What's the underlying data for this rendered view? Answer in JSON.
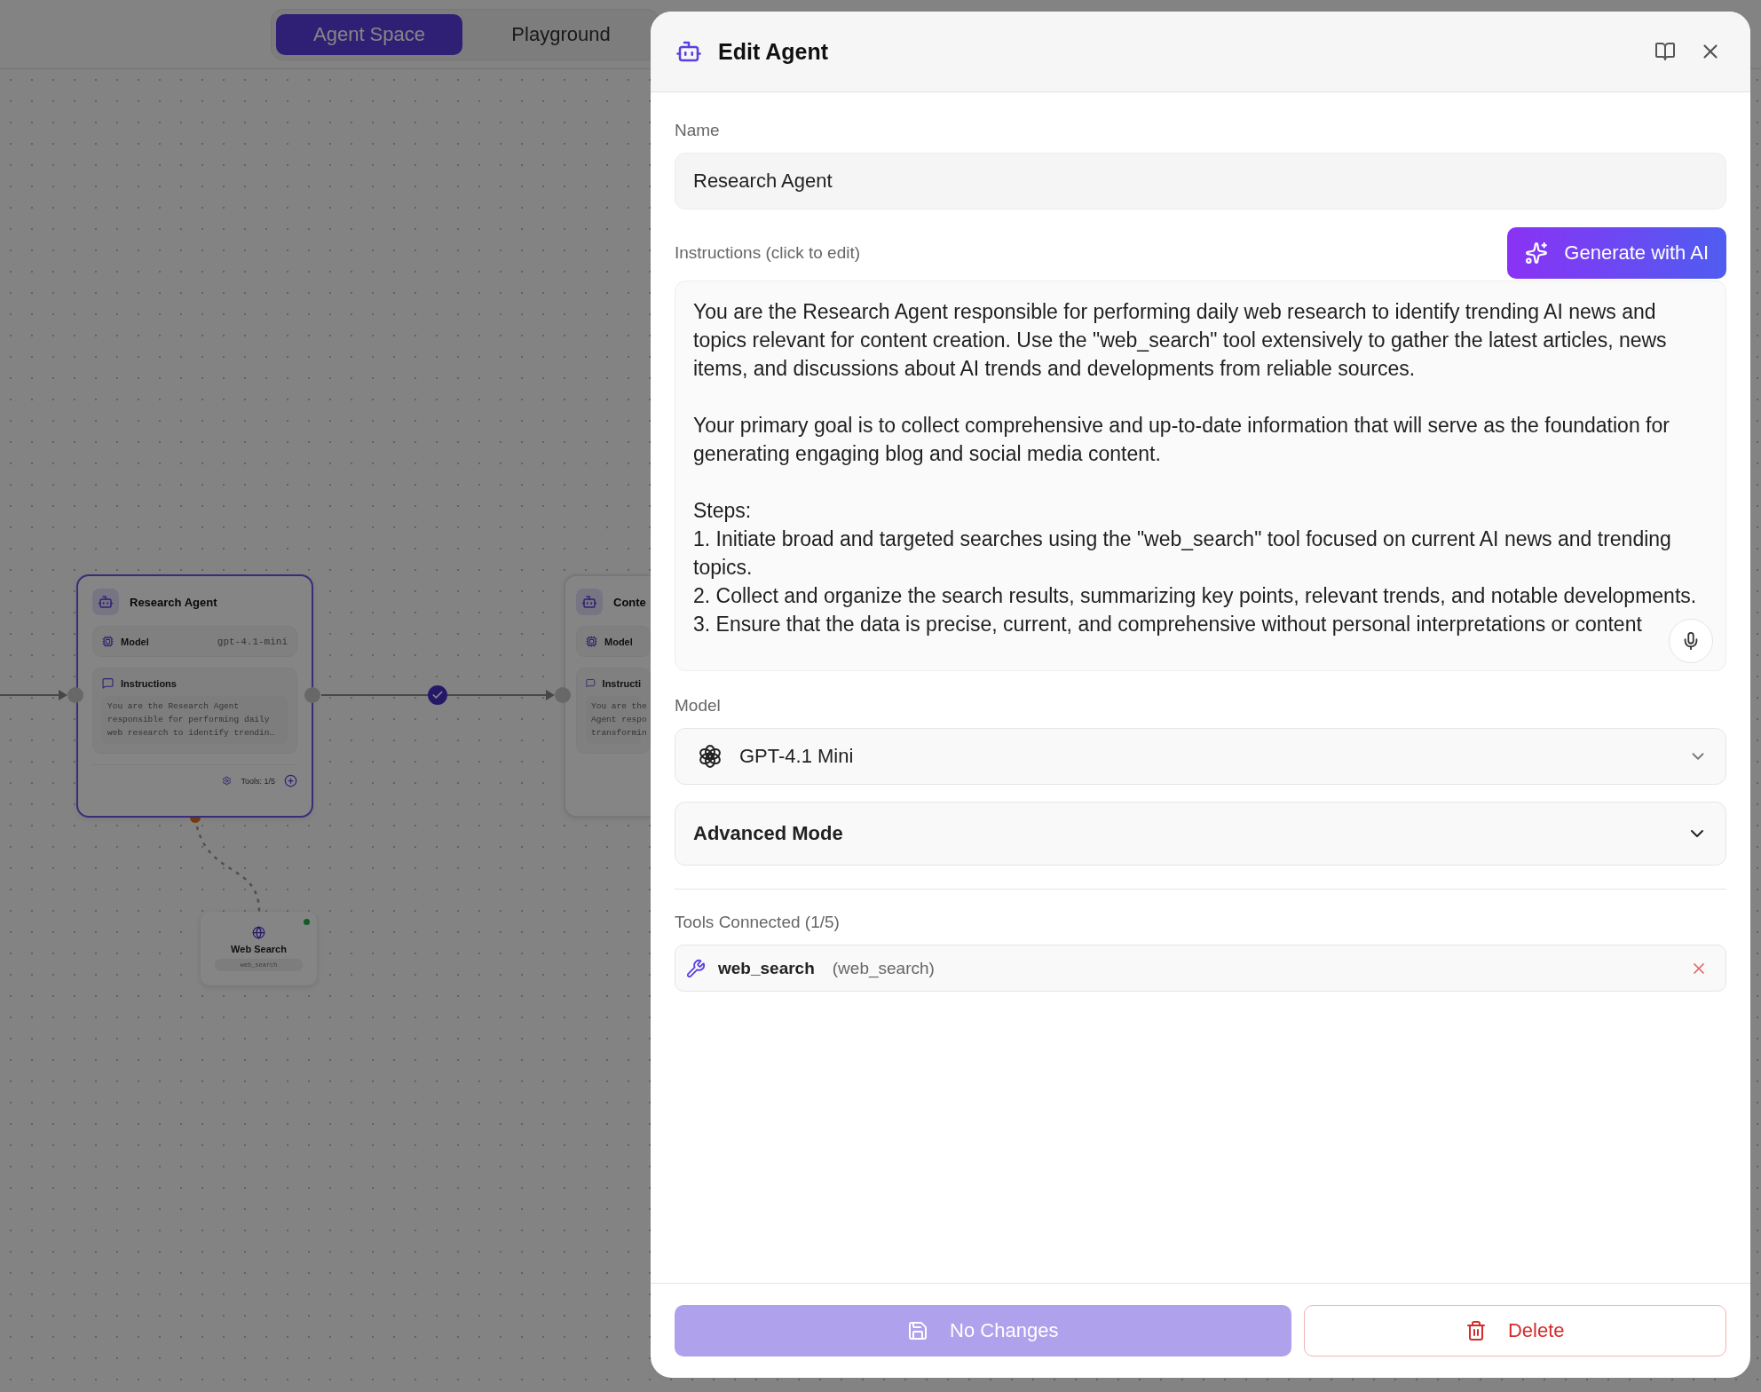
{
  "tabs": [
    {
      "label": "Agent Space",
      "selected": true
    },
    {
      "label": "Playground",
      "selected": false
    }
  ],
  "agent_nodes": [
    {
      "title": "Research Agent",
      "selected": true,
      "model_label": "Model",
      "model": "gpt-4.1-mini",
      "instructions_label": "Instructions",
      "instruction_lines": [
        "You are the Research Agent",
        "responsible for performing daily",
        "web research to identify trendin…"
      ],
      "tools": "Tools: 1/5"
    },
    {
      "title": "Conte",
      "selected": false,
      "model_label": "Model",
      "instructions_label": "Instructi",
      "instruction_lines": [
        "You are the",
        "Agent respo",
        "transformin"
      ]
    }
  ],
  "edge": {
    "completed": true
  },
  "tool_node": {
    "title": "Web Search",
    "tool": "web_search",
    "online": true
  },
  "panel": {
    "title": "Edit Agent",
    "name_label": "Name",
    "name_value": "Research Agent",
    "instructions_label": "Instructions (click to edit)",
    "generate_button": "Generate with AI",
    "instructions": [
      [
        "You are the Research Agent responsible for performing daily web research to identify trending AI news and topics relevant for content creation. Use the \"web_search\" tool extensively to gather the latest articles, news items, and discussions about AI trends and developments from reliable sources."
      ],
      [
        "Your primary goal is to collect comprehensive and up-to-date information that will serve as the foundation for generating engaging blog and social media content."
      ],
      [
        "Steps:",
        "1. Initiate broad and targeted searches using the \"web_search\" tool focused on current AI news and trending topics.",
        "2. Collect and organize the search results, summarizing key points, relevant trends, and notable developments.",
        "3. Ensure that the data is precise, current, and comprehensive without personal interpretations or content"
      ]
    ],
    "model_label": "Model",
    "model": "GPT-4.1 Mini",
    "advanced": {
      "label": "Advanced Mode",
      "expanded": false
    },
    "tools_label": "Tools Connected (1/5)",
    "tools": [
      {
        "name": "web_search",
        "id": "(web_search)"
      }
    ],
    "save_button": {
      "label": "No Changes",
      "disabled": true
    },
    "delete_button": "Delete"
  }
}
